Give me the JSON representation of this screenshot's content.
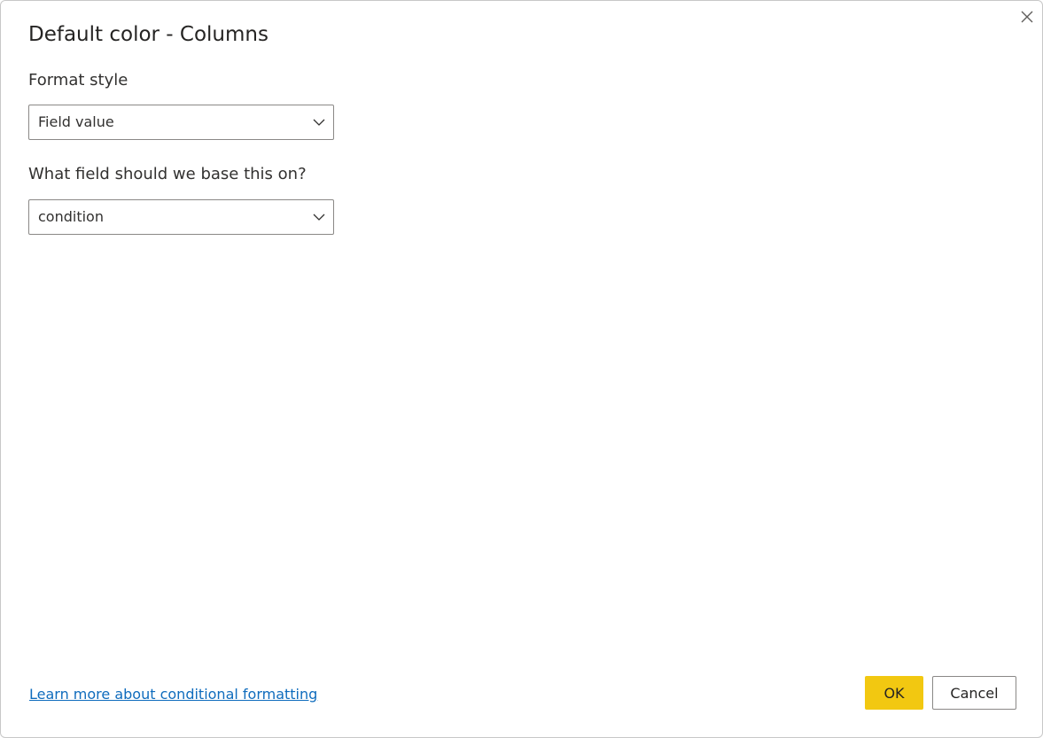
{
  "dialog": {
    "title": "Default color - Columns",
    "close_label": "Close"
  },
  "format_style": {
    "label": "Format style",
    "selected": "Field value"
  },
  "base_field": {
    "label": "What field should we base this on?",
    "selected": "condition"
  },
  "footer": {
    "learn_more": "Learn more about conditional formatting",
    "ok_label": "OK",
    "cancel_label": "Cancel"
  },
  "colors": {
    "accent": "#F2C811",
    "link": "#0F6CBD",
    "border": "#8A8886"
  },
  "icons": {
    "close": "close-icon",
    "dropdown": "chevron-down-icon"
  }
}
